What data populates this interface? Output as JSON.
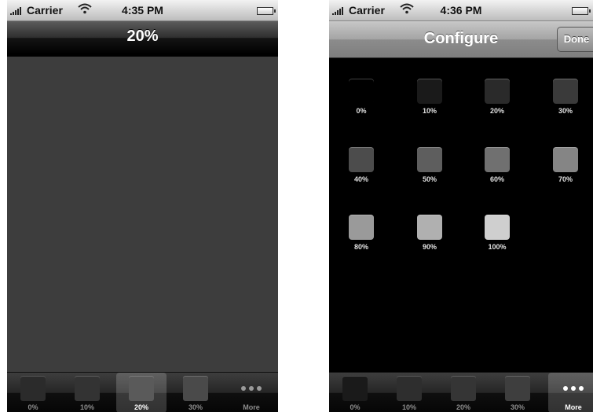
{
  "left_screen": {
    "status_bar": {
      "carrier": "Carrier",
      "time": "4:35 PM"
    },
    "nav_title": "20%",
    "tab_bar": {
      "tabs": [
        {
          "label": "0%",
          "shade": "#2b2b2b",
          "selected": false
        },
        {
          "label": "10%",
          "shade": "#333333",
          "selected": false
        },
        {
          "label": "20%",
          "shade": "#5a5a5a",
          "selected": true
        },
        {
          "label": "30%",
          "shade": "#4a4a4a",
          "selected": false
        },
        {
          "label": "More",
          "icon": "more-dots-icon",
          "selected": false
        }
      ]
    }
  },
  "right_screen": {
    "status_bar": {
      "carrier": "Carrier",
      "time": "4:36 PM"
    },
    "nav_title": "Configure",
    "done_label": "Done",
    "grid_items": [
      {
        "label": "0%",
        "shade": "#000000"
      },
      {
        "label": "10%",
        "shade": "#1a1a1a"
      },
      {
        "label": "20%",
        "shade": "#2a2a2a"
      },
      {
        "label": "30%",
        "shade": "#3a3a3a"
      },
      {
        "label": "40%",
        "shade": "#4c4c4c"
      },
      {
        "label": "50%",
        "shade": "#5e5e5e"
      },
      {
        "label": "60%",
        "shade": "#707070"
      },
      {
        "label": "70%",
        "shade": "#858585"
      },
      {
        "label": "80%",
        "shade": "#9a9a9a"
      },
      {
        "label": "90%",
        "shade": "#b0b0b0"
      },
      {
        "label": "100%",
        "shade": "#cfcfcf"
      }
    ],
    "tab_bar": {
      "tabs": [
        {
          "label": "0%",
          "shade": "#1a1a1a",
          "selected": false
        },
        {
          "label": "10%",
          "shade": "#2e2e2e",
          "selected": false
        },
        {
          "label": "20%",
          "shade": "#353535",
          "selected": false
        },
        {
          "label": "30%",
          "shade": "#3e3e3e",
          "selected": false
        },
        {
          "label": "More",
          "icon": "more-dots-icon",
          "selected": true
        }
      ]
    }
  }
}
